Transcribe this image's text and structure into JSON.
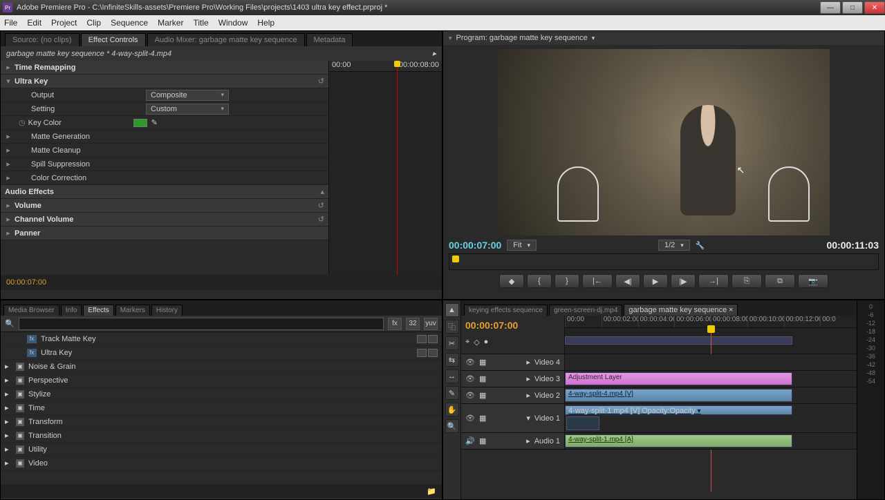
{
  "app": {
    "title": "Adobe Premiere Pro - C:\\InfiniteSkills-assets\\Premiere Pro\\Working Files\\projects\\1403 ultra key effect.prproj *",
    "icon_label": "Pr"
  },
  "menu": [
    "File",
    "Edit",
    "Project",
    "Clip",
    "Sequence",
    "Marker",
    "Title",
    "Window",
    "Help"
  ],
  "source_panel": {
    "tabs": [
      "Source: (no clips)",
      "Effect Controls",
      "Audio Mixer: garbage matte key sequence",
      "Metadata"
    ],
    "active_tab": 1,
    "clip_title": "garbage matte key sequence * 4-way-split-4.mp4",
    "mini_ruler": {
      "start": "00:00",
      "end": "00:00:08:00"
    },
    "sections": {
      "time_remapping": {
        "label": "Time Remapping"
      },
      "ultra_key": {
        "label": "Ultra Key",
        "output": {
          "label": "Output",
          "value": "Composite"
        },
        "setting": {
          "label": "Setting",
          "value": "Custom"
        },
        "key_color": {
          "label": "Key Color",
          "swatch": "#2a9b2a"
        },
        "subs": [
          "Matte Generation",
          "Matte Cleanup",
          "Spill Suppression",
          "Color Correction"
        ]
      },
      "audio_effects": {
        "label": "Audio Effects"
      },
      "volume": {
        "label": "Volume"
      },
      "channel_volume": {
        "label": "Channel Volume"
      },
      "panner": {
        "label": "Panner"
      }
    },
    "footer_tc": "00:00:07:00"
  },
  "program": {
    "header": "Program: garbage matte key sequence",
    "tc_left": "00:00:07:00",
    "fit": "Fit",
    "res": "1/2",
    "tc_right": "00:00:11:03"
  },
  "effects_panel": {
    "tabs": [
      "Media Browser",
      "Info",
      "Effects",
      "Markers",
      "History"
    ],
    "active_tab": 2,
    "search_placeholder": "",
    "toolbar_icons": [
      "fx",
      "32",
      "yuv"
    ],
    "items": [
      {
        "type": "fx",
        "label": "Track Matte Key",
        "badged": true
      },
      {
        "type": "fx",
        "label": "Ultra Key",
        "badged": true
      },
      {
        "type": "folder",
        "label": "Noise & Grain"
      },
      {
        "type": "folder",
        "label": "Perspective"
      },
      {
        "type": "folder",
        "label": "Stylize"
      },
      {
        "type": "folder",
        "label": "Time"
      },
      {
        "type": "folder",
        "label": "Transform"
      },
      {
        "type": "folder",
        "label": "Transition"
      },
      {
        "type": "folder",
        "label": "Utility"
      },
      {
        "type": "folder",
        "label": "Video"
      }
    ]
  },
  "timeline": {
    "tabs": [
      "keying effects sequence",
      "green-screen-dj.mp4",
      "garbage matte key sequence"
    ],
    "active_tab": 2,
    "tc": "00:00:07:00",
    "ruler": [
      "00:00",
      "00:00:02:00",
      "00:00:04:00",
      "00:00:06:00",
      "00:00:08:00",
      "00:00:10:00",
      "00:00:12:00",
      "00:0"
    ],
    "tracks": {
      "v4": {
        "label": "Video 4"
      },
      "v3": {
        "label": "Video 3",
        "clip": "Adjustment Layer"
      },
      "v2": {
        "label": "Video 2",
        "clip": "4-way-split-4.mp4 [V]"
      },
      "v1": {
        "label": "Video 1",
        "clip": "4-way-split-1.mp4 [V]",
        "opacity": "Opacity:Opacity"
      },
      "a1": {
        "label": "Audio 1",
        "clip": "4-way-split-1.mp4 [A]"
      }
    }
  },
  "tools": [
    "▲",
    "⿻",
    "✂",
    "⇆",
    "↔",
    "✎",
    "✋",
    "🔍"
  ],
  "transport": [
    "◆",
    "{",
    "}",
    "|←",
    "◀|",
    "▶",
    "|▶",
    "→|",
    "⎘",
    "⧉",
    "📷"
  ],
  "meter_ticks": [
    "0",
    "-6",
    "-12",
    "-18",
    "-24",
    "-30",
    "-36",
    "-42",
    "-48",
    "-54"
  ]
}
